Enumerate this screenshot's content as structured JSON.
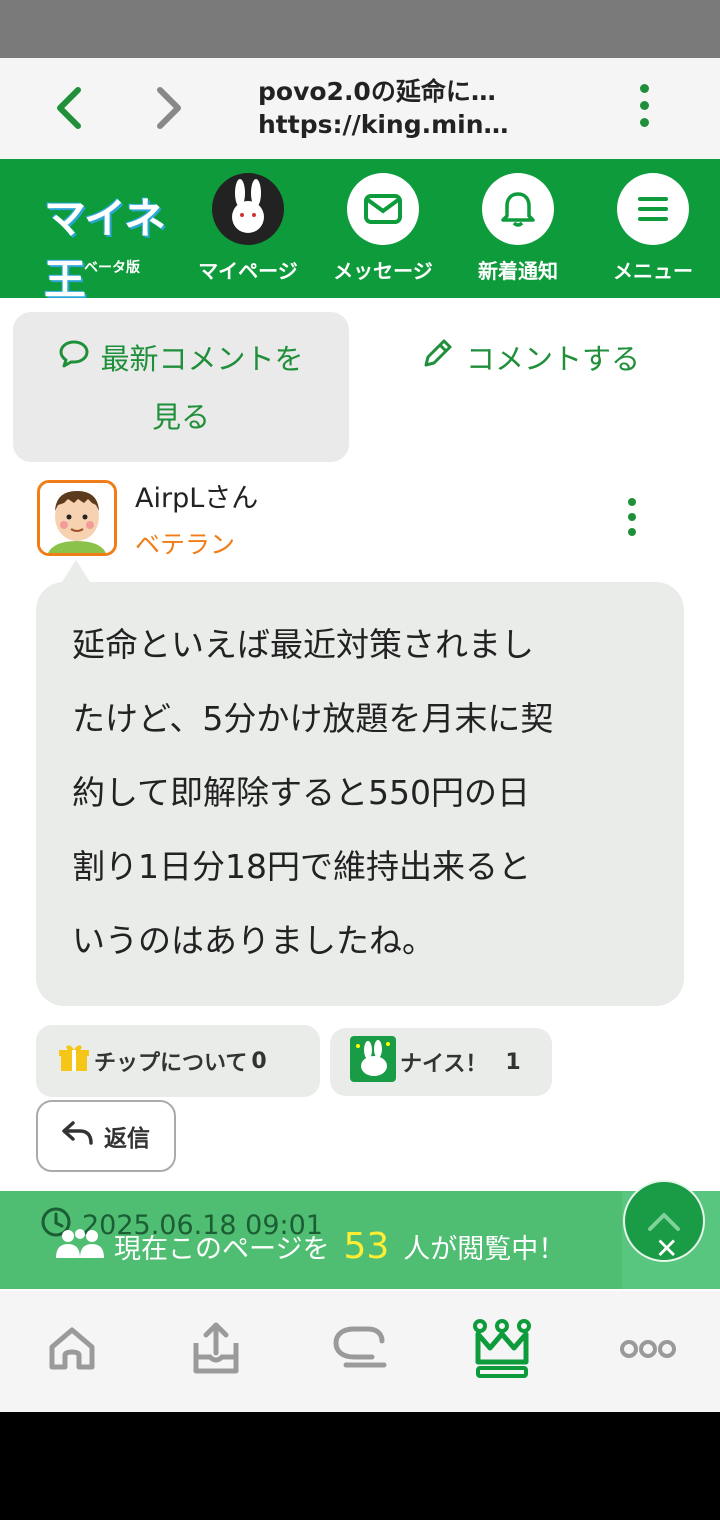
{
  "browser": {
    "title": "povo2.0の延命に…",
    "url": "https://king.min…"
  },
  "header": {
    "logo_text": "マイネ王",
    "logo_sub": "ベータ版",
    "items": [
      {
        "label": "マイページ",
        "icon": "avatar-icon"
      },
      {
        "label": "メッセージ",
        "icon": "mail-icon"
      },
      {
        "label": "新着通知",
        "icon": "bell-icon"
      },
      {
        "label": "メニュー",
        "icon": "hamburger-icon"
      }
    ]
  },
  "actions": {
    "latest_line1": "最新コメントを",
    "latest_line2": "見る",
    "comment": "コメントする"
  },
  "post": {
    "user_name": "AirpLさん",
    "user_rank": "ベテラン",
    "body_lines": [
      "延命といえば最近対策されまし",
      "たけど、5分かけ放題を月末に契",
      "約して即解除すると550円の日",
      "割り1日分18円で維持出来ると",
      "いうのはありましたね。"
    ],
    "tip_label": "チップについて",
    "tip_count": "0",
    "nice_label": "ナイス！",
    "nice_count": "1",
    "reply_label": "返信",
    "timestamp": "2025.06.18 09:01"
  },
  "viewers": {
    "prefix": "現在このページを",
    "count": "53",
    "suffix": "人が閲覧中！"
  },
  "colors": {
    "brand_green": "#0e9b3c",
    "accent_orange": "#f07d18",
    "bubble_bg": "#e9ece9"
  }
}
